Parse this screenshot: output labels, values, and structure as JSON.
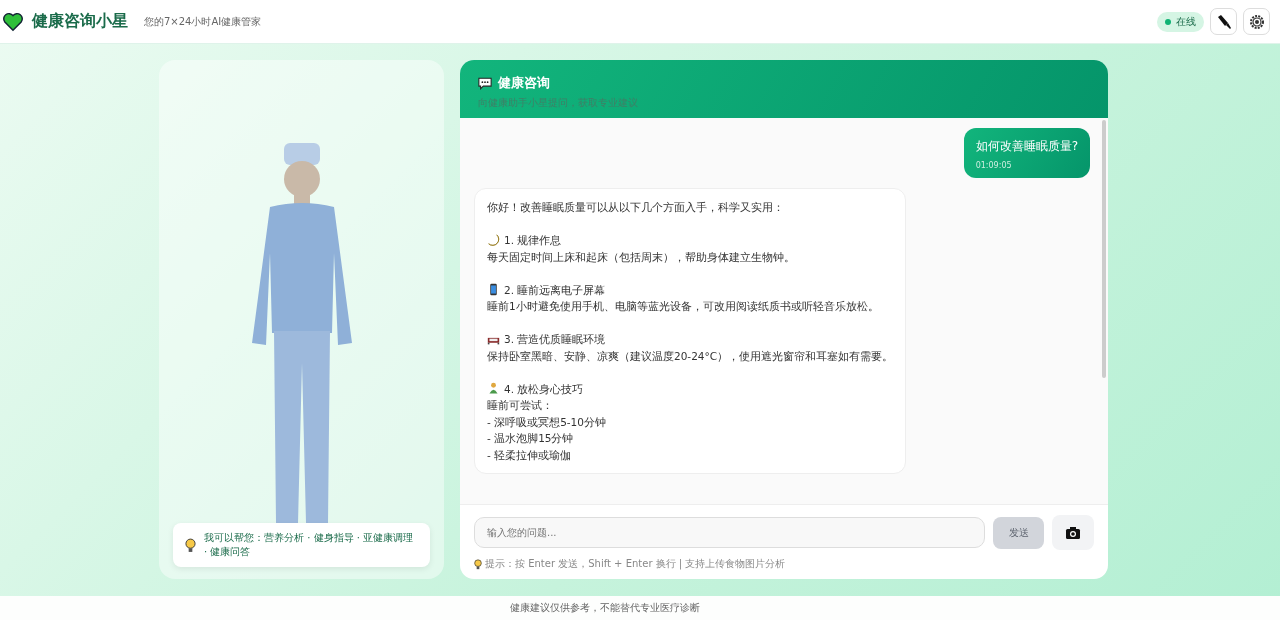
{
  "header": {
    "title": "健康咨询小星",
    "subtitle": "您的7×24小时AI健康管家",
    "status": {
      "label": "在线",
      "online": true
    }
  },
  "assistant_panel": {
    "tip": "我可以帮您：营养分析 · 健身指导 · 亚健康调理 · 健康问答"
  },
  "chat": {
    "title": "健康咨询",
    "subtitle": "向健康助手小星提问，获取专业建议",
    "user_message": {
      "text": "如何改善睡眠质量?",
      "time": "01:09:05"
    },
    "assistant_message": {
      "intro": "你好！改善睡眠质量可以从以下几个方面入手，科学又实用：",
      "sections": [
        {
          "heading": "1. 规律作息",
          "lines": [
            "每天固定时间上床和起床（包括周末），帮助身体建立生物钟。"
          ]
        },
        {
          "heading": "2. 睡前远离电子屏幕",
          "lines": [
            "睡前1小时避免使用手机、电脑等蓝光设备，可改用阅读纸质书或听轻音乐放松。"
          ]
        },
        {
          "heading": "3. 营造优质睡眠环境",
          "lines": [
            "保持卧室黑暗、安静、凉爽（建议温度20-24°C），使用遮光窗帘和耳塞如有需要。"
          ]
        },
        {
          "heading": "4. 放松身心技巧",
          "lines": [
            "睡前可尝试：",
            "- 深呼吸或冥想5-10分钟",
            "- 温水泡脚15分钟",
            "- 轻柔拉伸或瑜伽"
          ]
        }
      ]
    },
    "input": {
      "placeholder": "输入您的问题...",
      "send_label": "发送",
      "send_disabled": true
    },
    "hint": "提示：按 Enter 发送，Shift + Enter 换行 | 支持上传食物图片分析"
  },
  "footer": "健康建议仅供参考，不能替代专业医疗诊断"
}
